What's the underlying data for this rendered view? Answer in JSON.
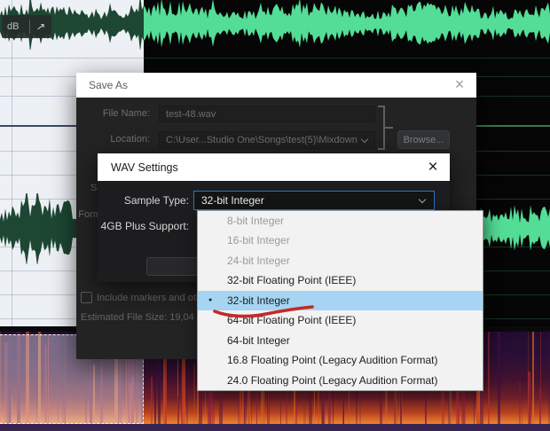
{
  "editor": {
    "db_hud_label": "dB",
    "waveform_color": "#54dd96",
    "selected_waveform_color": "#1d4733",
    "selection_bg": "#edf0f4"
  },
  "save_as": {
    "title": "Save As",
    "close_glyph": "×",
    "file_name_label": "File Name:",
    "file_name_value": "test-48.wav",
    "location_label": "Location:",
    "location_value": "C:\\User...Studio One\\Songs\\test(5)\\Mixdown",
    "browse_button": "Browse...",
    "sample_type_label": "Sample Type:",
    "format_settings_label": "Format Settings:",
    "include_markers_label": "Include markers and other metadata",
    "estimated_file_size": "Estimated File Size: 19,04"
  },
  "wav_settings": {
    "title": "WAV Settings",
    "close_glyph": "×",
    "sample_type_label": "Sample Type:",
    "sample_type_value": "32-bit Integer",
    "support_label": "4GB Plus Support:"
  },
  "dropdown": {
    "items": [
      {
        "label": "8-bit Integer",
        "state": "disabled"
      },
      {
        "label": "16-bit Integer",
        "state": "disabled"
      },
      {
        "label": "24-bit Integer",
        "state": "disabled"
      },
      {
        "label": "32-bit Floating Point (IEEE)",
        "state": "normal"
      },
      {
        "label": "32-bit Integer",
        "state": "selected"
      },
      {
        "label": "64-bit Floating Point (IEEE)",
        "state": "normal"
      },
      {
        "label": "64-bit Integer",
        "state": "normal"
      },
      {
        "label": "16.8 Floating Point (Legacy Audition Format)",
        "state": "normal"
      },
      {
        "label": "24.0 Floating Point (Legacy Audition Format)",
        "state": "normal"
      }
    ]
  },
  "annotation": {
    "type": "hand-drawn red underline under 32-bit Integer",
    "color": "#c62828"
  }
}
